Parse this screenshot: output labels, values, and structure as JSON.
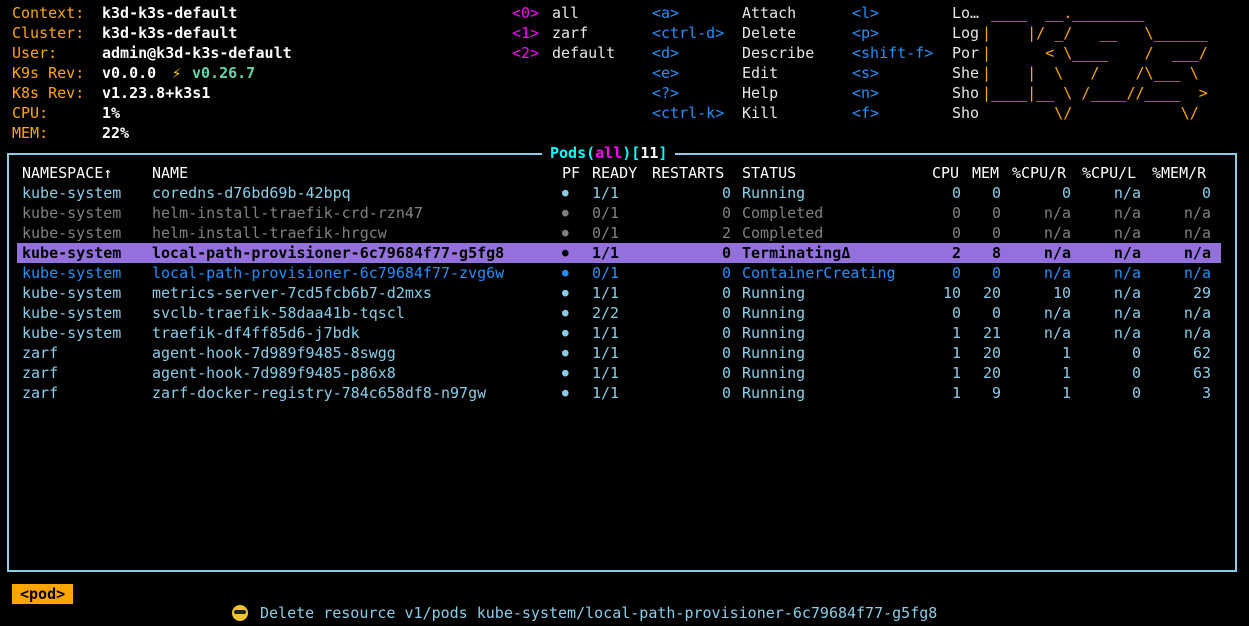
{
  "info": {
    "labels": [
      "Context:",
      "Cluster:",
      "User:",
      "K9s Rev:",
      "K8s Rev:",
      "CPU:",
      "MEM:"
    ],
    "context": "k3d-k3s-default",
    "cluster": "k3d-k3s-default",
    "user": "admin@k3d-k3s-default",
    "k9s_rev": "v0.0.0",
    "k9s_rev_latest": "v0.26.7",
    "k8s_rev": "v1.23.8+k3s1",
    "cpu": "1%",
    "mem": "22%"
  },
  "namespaces": [
    {
      "key": "<0>",
      "name": "all"
    },
    {
      "key": "<1>",
      "name": "zarf"
    },
    {
      "key": "<2>",
      "name": "default"
    }
  ],
  "hotkeys_col1": [
    {
      "key": "<a>",
      "label": "Attach"
    },
    {
      "key": "<ctrl-d>",
      "label": "Delete"
    },
    {
      "key": "<d>",
      "label": "Describe"
    },
    {
      "key": "<e>",
      "label": "Edit"
    },
    {
      "key": "<?>",
      "label": "Help"
    },
    {
      "key": "<ctrl-k>",
      "label": "Kill"
    }
  ],
  "hotkeys_col2": [
    {
      "key": "<l>",
      "label": "Lo…"
    },
    {
      "key": "<p>",
      "label": "Log"
    },
    {
      "key": "<shift-f>",
      "label": "Por"
    },
    {
      "key": "<s>",
      "label": "She"
    },
    {
      "key": "<n>",
      "label": "Sho"
    },
    {
      "key": "<f>",
      "label": "Sho"
    }
  ],
  "logo_lines": [
    " ____  __.________       ",
    "|    |/ _/   __   \\______",
    "|      < \\____    /  ___/",
    "|    |  \\   /    /\\___ \\ ",
    "|____|__ \\ /____//____  >",
    "        \\/            \\/ "
  ],
  "table": {
    "title_name": "Pods",
    "title_ns": "all",
    "title_count": "11",
    "headers": {
      "namespace": "NAMESPACE↑",
      "name": "NAME",
      "pf": "PF",
      "ready": "READY",
      "restarts": "RESTARTS",
      "status": "STATUS",
      "cpu": "CPU",
      "mem": "MEM",
      "pcpu_r": "%CPU/R",
      "pcpu_l": "%CPU/L",
      "pmem_r": "%MEM/R"
    },
    "rows": [
      {
        "state": "normal",
        "namespace": "kube-system",
        "name": "coredns-d76bd69b-42bpq",
        "pf": "●",
        "ready": "1/1",
        "restarts": "0",
        "status": "Running",
        "cpu": "0",
        "mem": "0",
        "pcpu_r": "0",
        "pcpu_l": "n/a",
        "pmem_r": "0"
      },
      {
        "state": "completed",
        "namespace": "kube-system",
        "name": "helm-install-traefik-crd-rzn47",
        "pf": "●",
        "ready": "0/1",
        "restarts": "0",
        "status": "Completed",
        "cpu": "0",
        "mem": "0",
        "pcpu_r": "n/a",
        "pcpu_l": "n/a",
        "pmem_r": "n/a"
      },
      {
        "state": "completed",
        "namespace": "kube-system",
        "name": "helm-install-traefik-hrgcw",
        "pf": "●",
        "ready": "0/1",
        "restarts": "2",
        "status": "Completed",
        "cpu": "0",
        "mem": "0",
        "pcpu_r": "n/a",
        "pcpu_l": "n/a",
        "pmem_r": "n/a"
      },
      {
        "state": "selected",
        "namespace": "kube-system",
        "name": "local-path-provisioner-6c79684f77-g5fg8",
        "pf": "●",
        "ready": "1/1",
        "restarts": "0",
        "status": "TerminatingΔ",
        "cpu": "2",
        "mem": "8",
        "pcpu_r": "n/a",
        "pcpu_l": "n/a",
        "pmem_r": "n/a"
      },
      {
        "state": "creating",
        "namespace": "kube-system",
        "name": "local-path-provisioner-6c79684f77-zvg6w",
        "pf": "●",
        "ready": "0/1",
        "restarts": "0",
        "status": "ContainerCreating",
        "cpu": "0",
        "mem": "0",
        "pcpu_r": "n/a",
        "pcpu_l": "n/a",
        "pmem_r": "n/a"
      },
      {
        "state": "normal",
        "namespace": "kube-system",
        "name": "metrics-server-7cd5fcb6b7-d2mxs",
        "pf": "●",
        "ready": "1/1",
        "restarts": "0",
        "status": "Running",
        "cpu": "10",
        "mem": "20",
        "pcpu_r": "10",
        "pcpu_l": "n/a",
        "pmem_r": "29"
      },
      {
        "state": "normal",
        "namespace": "kube-system",
        "name": "svclb-traefik-58daa41b-tqscl",
        "pf": "●",
        "ready": "2/2",
        "restarts": "0",
        "status": "Running",
        "cpu": "0",
        "mem": "0",
        "pcpu_r": "n/a",
        "pcpu_l": "n/a",
        "pmem_r": "n/a"
      },
      {
        "state": "normal",
        "namespace": "kube-system",
        "name": "traefik-df4ff85d6-j7bdk",
        "pf": "●",
        "ready": "1/1",
        "restarts": "0",
        "status": "Running",
        "cpu": "1",
        "mem": "21",
        "pcpu_r": "n/a",
        "pcpu_l": "n/a",
        "pmem_r": "n/a"
      },
      {
        "state": "normal",
        "namespace": "zarf",
        "name": "agent-hook-7d989f9485-8swgg",
        "pf": "●",
        "ready": "1/1",
        "restarts": "0",
        "status": "Running",
        "cpu": "1",
        "mem": "20",
        "pcpu_r": "1",
        "pcpu_l": "0",
        "pmem_r": "62"
      },
      {
        "state": "normal",
        "namespace": "zarf",
        "name": "agent-hook-7d989f9485-p86x8",
        "pf": "●",
        "ready": "1/1",
        "restarts": "0",
        "status": "Running",
        "cpu": "1",
        "mem": "20",
        "pcpu_r": "1",
        "pcpu_l": "0",
        "pmem_r": "63"
      },
      {
        "state": "normal",
        "namespace": "zarf",
        "name": "zarf-docker-registry-784c658df8-n97gw",
        "pf": "●",
        "ready": "1/1",
        "restarts": "0",
        "status": "Running",
        "cpu": "1",
        "mem": "9",
        "pcpu_r": "1",
        "pcpu_l": "0",
        "pmem_r": "3"
      }
    ]
  },
  "breadcrumb": "<pod>",
  "flash": "Delete resource v1/pods kube-system/local-path-provisioner-6c79684f77-g5fg8",
  "flash_icon": "sunglasses-emoji-icon"
}
